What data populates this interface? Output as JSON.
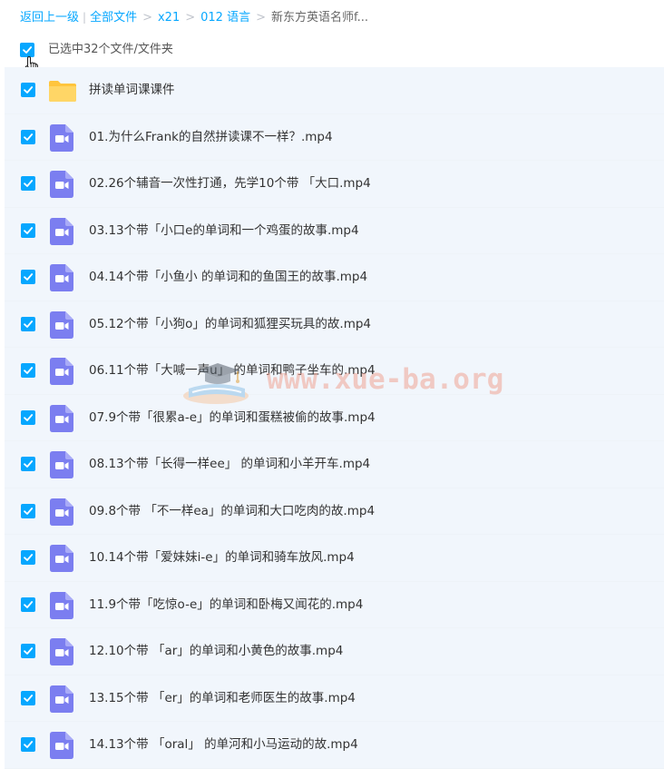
{
  "breadcrumb": {
    "back": "返回上一级",
    "all_files": "全部文件",
    "path": [
      "x21",
      "012 语言"
    ],
    "current": "新东方英语名师f..."
  },
  "selection": {
    "text": "已选中32个文件/文件夹",
    "all_checked": true
  },
  "files": [
    {
      "name": "拼读单词课课件",
      "type": "folder",
      "checked": true
    },
    {
      "name": "01.为什么Frank的自然拼读课不一样？.mp4",
      "type": "video",
      "checked": true
    },
    {
      "name": "02.26个辅音一次性打通，先学10个带 「大口.mp4",
      "type": "video",
      "checked": true
    },
    {
      "name": "03.13个带「小口e的单词和一个鸡蛋的故事.mp4",
      "type": "video",
      "checked": true
    },
    {
      "name": "04.14个带「小鱼小 的单词和的鱼国王的故事.mp4",
      "type": "video",
      "checked": true
    },
    {
      "name": "05.12个带「小狗o」的单词和狐狸买玩具的故.mp4",
      "type": "video",
      "checked": true
    },
    {
      "name": "06.11个带「大喊一声u」 的单词和鸭子坐车的.mp4",
      "type": "video",
      "checked": true
    },
    {
      "name": "07.9个带「很累a-e」的单词和蛋糕被偷的故事.mp4",
      "type": "video",
      "checked": true
    },
    {
      "name": "08.13个带「长得一样ee」 的单词和小羊开车.mp4",
      "type": "video",
      "checked": true
    },
    {
      "name": "09.8个带 「不一样ea」的单词和大口吃肉的故.mp4",
      "type": "video",
      "checked": true
    },
    {
      "name": "10.14个带「爱妹妹i-e」的单词和骑车放风.mp4",
      "type": "video",
      "checked": true
    },
    {
      "name": "11.9个带「吃惊o-e」的单词和卧梅又闻花的.mp4",
      "type": "video",
      "checked": true
    },
    {
      "name": "12.10个带 「ar」的单词和小黄色的故事.mp4",
      "type": "video",
      "checked": true
    },
    {
      "name": "13.15个带 「er」的单词和老师医生的故事.mp4",
      "type": "video",
      "checked": true
    },
    {
      "name": "14.13个带 「oral」 的单河和小马运动的故.mp4",
      "type": "video",
      "checked": true
    }
  ],
  "watermark": {
    "text": "www.xue-ba.org"
  },
  "colors": {
    "accent": "#06a7ff",
    "folder": "#ffc53d",
    "video": "#7b7ef0",
    "row_bg": "#f1f6fc"
  }
}
